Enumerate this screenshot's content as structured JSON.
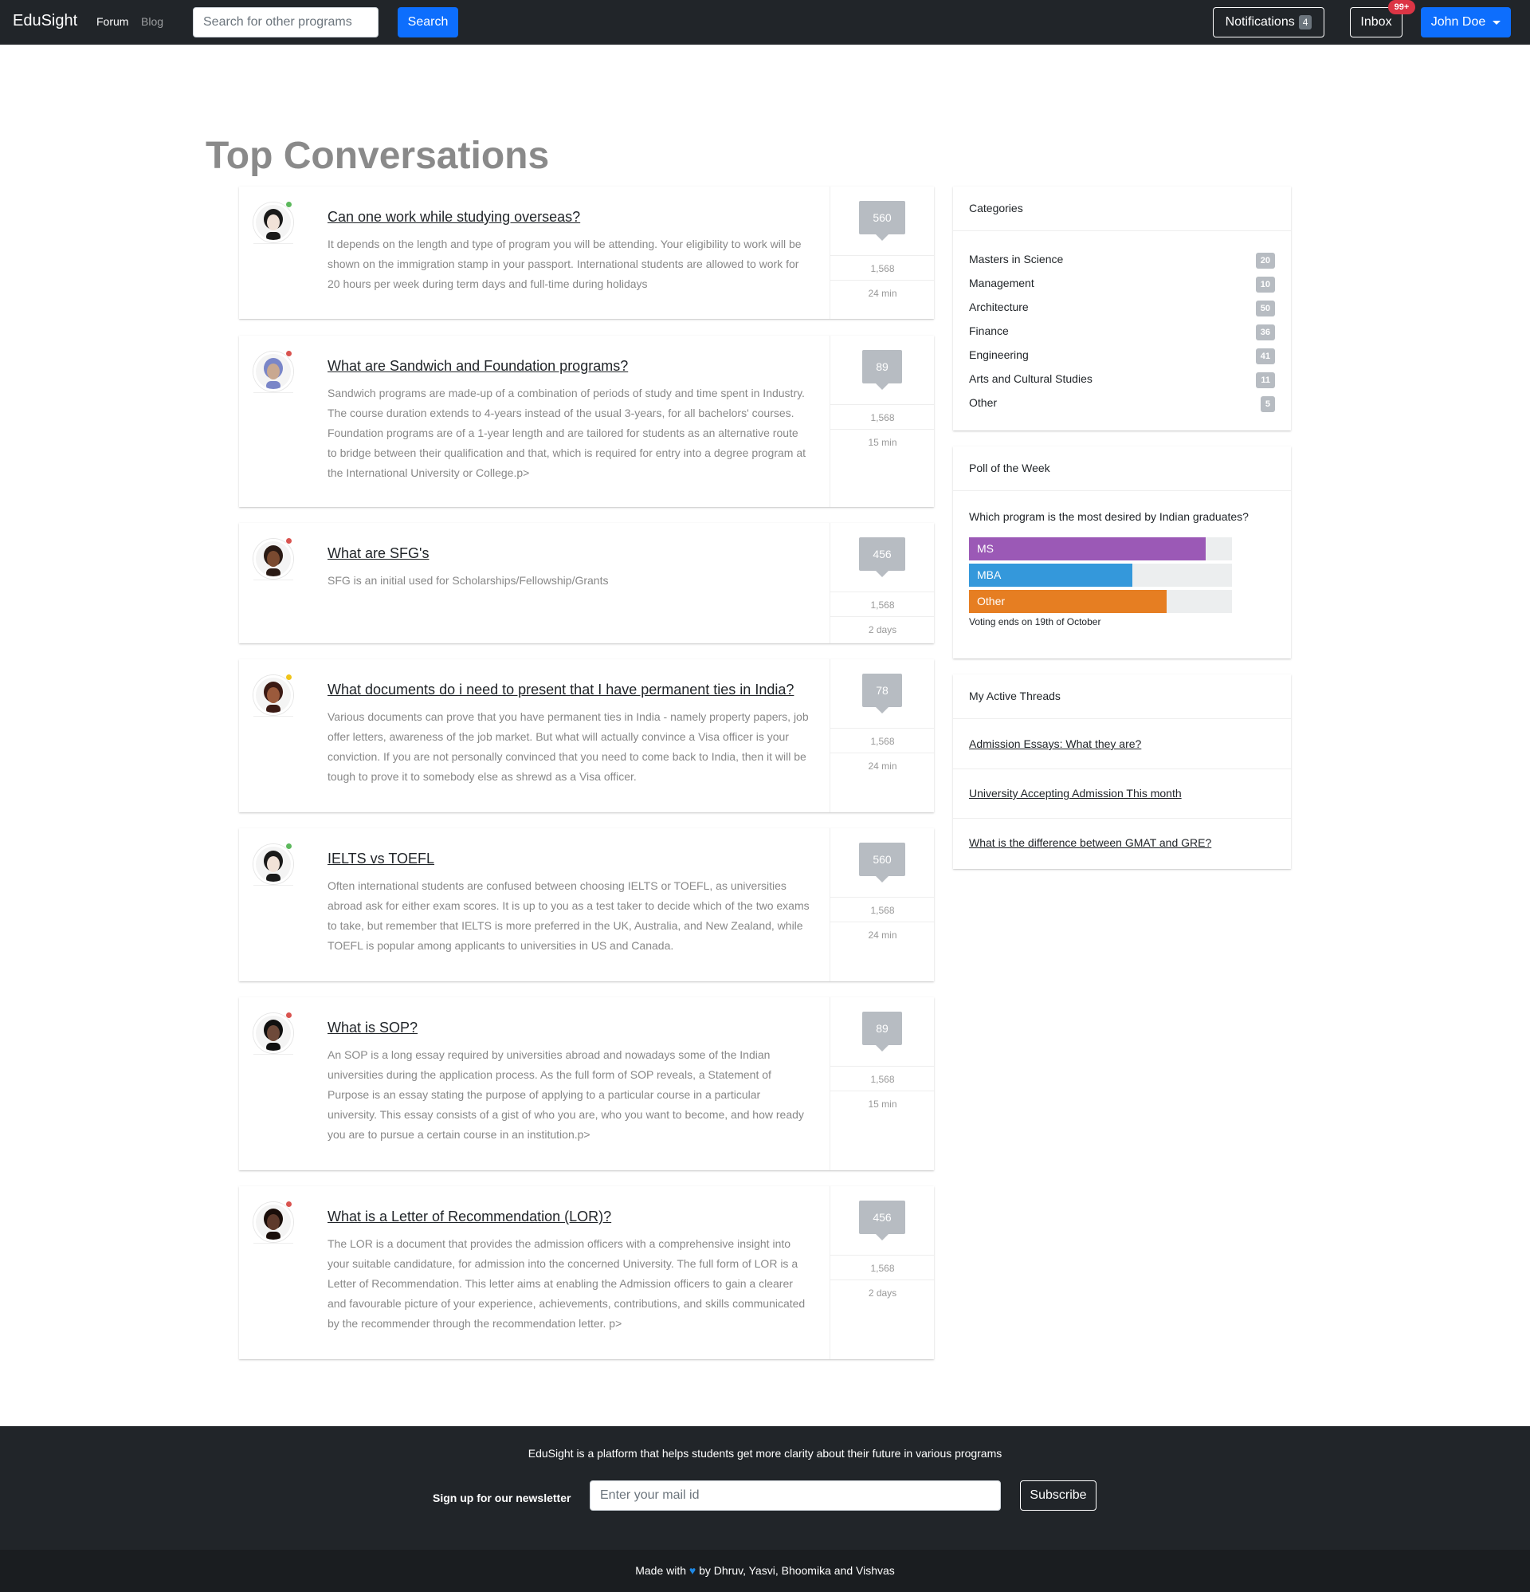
{
  "navbar": {
    "brand": "EduSight",
    "forum": "Forum",
    "blog": "Blog",
    "search_placeholder": "Search for other programs",
    "search_button": "Search",
    "notifications_label": "Notifications",
    "notifications_count": "4",
    "inbox_label": "Inbox",
    "inbox_badge": "99+",
    "user_name": "John Doe"
  },
  "page_title": "Top Conversations",
  "threads": [
    {
      "title": "Can one work while studying overseas?",
      "body": "It depends on the length and type of program you will be attending. Your eligibility to work will be shown on the immigration stamp in your passport. International students are allowed to work for 20 hours per week during term days and full-time during holidays",
      "count": "560",
      "views": "1,568",
      "time": "24 min",
      "status_color": "#5cb85c"
    },
    {
      "title": "What are Sandwich and Foundation programs?",
      "body": "Sandwich programs are made-up of a combination of periods of study and time spent in Industry. The course duration extends to 4-years instead of the usual 3-years, for all bachelors' courses. Foundation programs are of a 1-year length and are tailored for students as an alternative route to bridge between their qualification and that, which is required for entry into a degree program at the International University or College.p>",
      "count": "89",
      "views": "1,568",
      "time": "15 min",
      "status_color": "#d9534f"
    },
    {
      "title": "What are SFG's",
      "body": "SFG is an initial used for Scholarships/Fellowship/Grants",
      "count": "456",
      "views": "1,568",
      "time": "2 days",
      "status_color": "#d9534f"
    },
    {
      "title": "What documents do i need to present that I have permanent ties in India?",
      "body": "Various documents can prove that you have permanent ties in India - namely property papers, job offer letters, awareness of the job market. But what will actually convince a Visa officer is your conviction. If you are not personally convinced that you need to come back to India, then it will be tough to prove it to somebody else as shrewd as a Visa officer.",
      "count": "78",
      "views": "1,568",
      "time": "24 min",
      "status_color": "#f0c419"
    },
    {
      "title": "IELTS vs TOEFL",
      "body": "Often international students are confused between choosing IELTS or TOEFL, as universities abroad ask for either exam scores. It is up to you as a test taker to decide which of the two exams to take, but remember that IELTS is more preferred in the UK, Australia, and New Zealand, while TOEFL is popular among applicants to universities in US and Canada.",
      "count": "560",
      "views": "1,568",
      "time": "24 min",
      "status_color": "#5cb85c"
    },
    {
      "title": "What is SOP?",
      "body": "An SOP is a long essay required by universities abroad and nowadays some of the Indian universities during the application process. As the full form of SOP reveals, a Statement of Purpose is an essay stating the purpose of applying to a particular course in a particular university. This essay consists of a gist of who you are, who you want to become, and how ready you are to pursue a certain course in an institution.p>",
      "count": "89",
      "views": "1,568",
      "time": "15 min",
      "status_color": "#d9534f"
    },
    {
      "title": "What is a Letter of Recommendation (LOR)?",
      "body": "The LOR is a document that provides the admission officers with a comprehensive insight into your suitable candidature, for admission into the concerned University. The full form of LOR is a Letter of Recommendation. This letter aims at enabling the Admission officers to gain a clearer and favourable picture of your experience, achievements, contributions, and skills communicated by the recommender through the recommendation letter. p>",
      "count": "456",
      "views": "1,568",
      "time": "2 days",
      "status_color": "#d9534f"
    }
  ],
  "categories": {
    "title": "Categories",
    "items": [
      {
        "label": "Masters in Science",
        "count": "20"
      },
      {
        "label": "Management",
        "count": "10"
      },
      {
        "label": "Architecture",
        "count": "50"
      },
      {
        "label": "Finance",
        "count": "36"
      },
      {
        "label": "Engineering",
        "count": "41"
      },
      {
        "label": "Arts and Cultural Studies",
        "count": "11"
      },
      {
        "label": "Other",
        "count": "5"
      }
    ]
  },
  "poll": {
    "title": "Poll of the Week",
    "question": "Which program is the most desired by Indian graduates?",
    "options": [
      {
        "label": "MS",
        "fraction": 0.9,
        "color": "#9b59b6"
      },
      {
        "label": "MBA",
        "fraction": 0.62,
        "color": "#3498db"
      },
      {
        "label": "Other",
        "fraction": 0.75,
        "color": "#e67e22"
      }
    ],
    "note": "Voting ends on 19th of October"
  },
  "active_threads": {
    "title": "My Active Threads",
    "items": [
      "Admission Essays: What they are?",
      "University Accepting Admission This month",
      "What is the difference between GMAT and GRE?"
    ]
  },
  "footer": {
    "tagline": "EduSight is a platform that helps students get more clarity about their future in various programs",
    "newsletter_label": "Sign up for our newsletter",
    "email_placeholder": "Enter your mail id",
    "subscribe": "Subscribe",
    "credits_prefix": "Made with",
    "credits_suffix": "by Dhruv, Yasvi, Bhoomika and Vishvas"
  }
}
